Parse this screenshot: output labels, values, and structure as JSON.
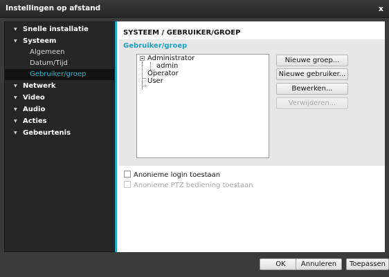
{
  "window": {
    "title": "Instellingen op afstand",
    "close_glyph": "x"
  },
  "sidebar": {
    "items": [
      {
        "label": "Snelle installatie",
        "arrow": "▼"
      },
      {
        "label": "Systeem",
        "arrow": "▼",
        "children": [
          "Algemeen",
          "Datum/Tijd",
          "Gebruiker/groep"
        ]
      },
      {
        "label": "Netwerk",
        "arrow": "▼"
      },
      {
        "label": "Video",
        "arrow": "▼"
      },
      {
        "label": "Audio",
        "arrow": "▼"
      },
      {
        "label": "Acties",
        "arrow": "▼"
      },
      {
        "label": "Gebeurtenis",
        "arrow": "▼"
      }
    ],
    "active_child": "Gebruiker/groep"
  },
  "main": {
    "page_title": "SYSTEEM / GEBRUIKER/GROEP",
    "group_title": "Gebruiker/groep",
    "tree": {
      "nodes": [
        "Administrator",
        "admin",
        "Operator",
        "User"
      ]
    },
    "buttons": {
      "new_group": "Nieuwe groep...",
      "new_user": "Nieuwe gebruiker...",
      "edit": "Bewerken...",
      "delete": "Verwijderen..."
    },
    "checkboxes": {
      "anonymous_login": "Anonieme login toestaan",
      "anonymous_ptz": "Anonieme PTZ bediening toestaan"
    }
  },
  "footer": {
    "ok": "OK",
    "cancel": "Annuleren",
    "apply": "Toepassen"
  },
  "colors": {
    "accent": "#1aa7bf",
    "active_text": "#2ab7c9",
    "sidebar_bg": "#262626"
  }
}
